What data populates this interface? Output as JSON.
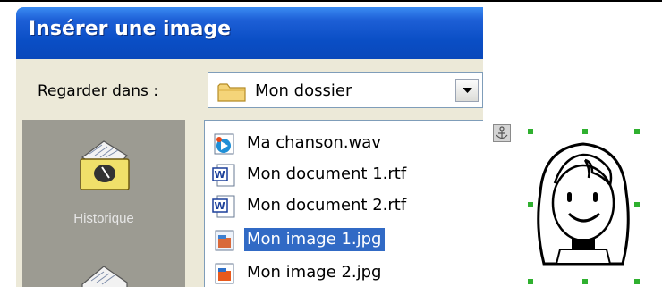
{
  "dialog": {
    "title": "Insérer une image",
    "look_in": {
      "label_before": "Regarder ",
      "label_access": "d",
      "label_after": "ans :",
      "value": "Mon dossier"
    },
    "places": [
      {
        "label": "Historique",
        "icon": "history-icon"
      }
    ],
    "files": [
      {
        "name": "Ma chanson.wav",
        "icon": "audio-file-icon",
        "selected": false
      },
      {
        "name": "Mon document 1.rtf",
        "icon": "word-document-icon",
        "selected": false
      },
      {
        "name": "Mon document 2.rtf",
        "icon": "word-document-icon",
        "selected": false
      },
      {
        "name": "Mon image 1.jpg",
        "icon": "image-file-icon",
        "selected": true
      },
      {
        "name": "Mon image 2.jpg",
        "icon": "image-file-icon",
        "selected": false
      }
    ]
  },
  "clipart": {
    "subject": "girl-face-clipart",
    "anchor": "anchor-icon",
    "selection_handles": 8
  },
  "colors": {
    "titlebar": "#0a4ec5",
    "selection": "#316ac5",
    "handles": "#2fb02f",
    "dialog_bg": "#ece9d8"
  }
}
